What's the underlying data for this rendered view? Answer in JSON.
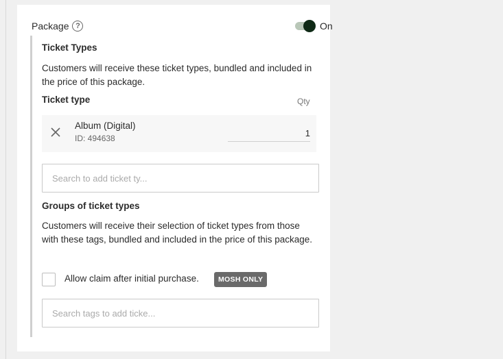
{
  "package": {
    "label": "Package",
    "help_icon": "question-circle-icon",
    "help_glyph": "?",
    "toggle_state": "On"
  },
  "ticket_types": {
    "heading": "Ticket Types",
    "description": "Customers will receive these ticket types, bundled and included in the price of this package.",
    "column_ticket_type": "Ticket type",
    "column_qty": "Qty",
    "items": [
      {
        "name": "Album (Digital)",
        "id": "ID: 494638",
        "qty": "1",
        "remove_icon": "close-icon"
      }
    ],
    "search_placeholder": "Search to add ticket ty..."
  },
  "groups": {
    "heading": "Groups of ticket types",
    "description": "Customers will receive their selection of ticket types from those with these tags, bundled and included in the price of this package.",
    "checkbox_label": "Allow claim after initial purchase.",
    "badge": "MOSH ONLY",
    "search_placeholder": "Search tags to add ticke..."
  },
  "colors": {
    "toggle_knob": "#0f2a16",
    "toggle_track": "#b9c7b8",
    "badge_bg": "#6a6a6a"
  }
}
